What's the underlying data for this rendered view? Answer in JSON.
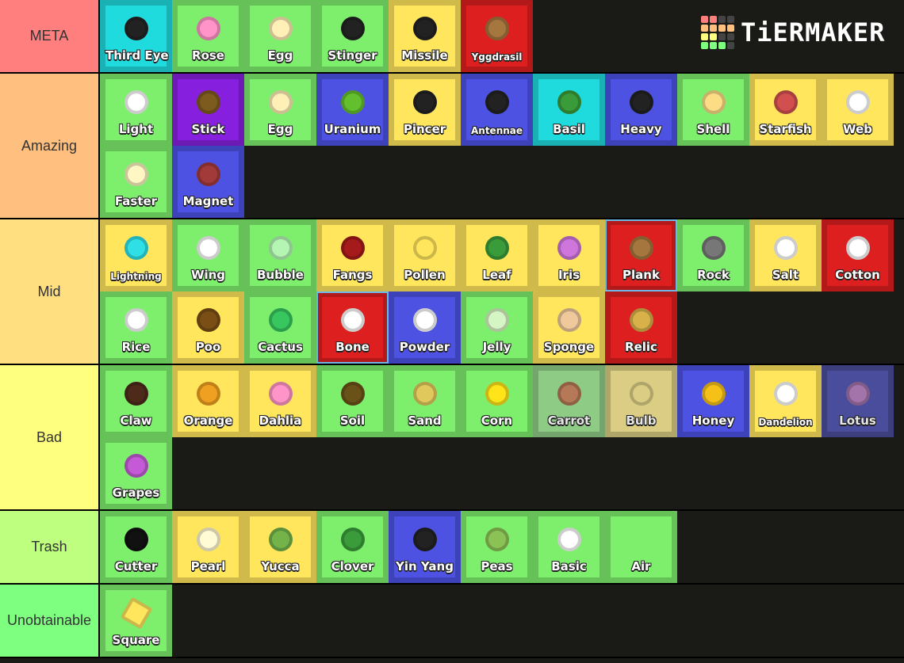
{
  "brand": {
    "name": "TiERMAKER",
    "grid_colors": [
      "#ff7f7f",
      "#ff7f7f",
      "#444",
      "#444",
      "#ffbf7f",
      "#ffbf7f",
      "#ffbf7f",
      "#ffbf7f",
      "#ffff7f",
      "#ffff7f",
      "#444",
      "#444",
      "#7fff7f",
      "#7fff7f",
      "#7fff7f",
      "#444"
    ]
  },
  "rarity_colors": {
    "common": [
      "#7eef6d",
      "#66c258"
    ],
    "unusual": [
      "#ffe65d",
      "#cfba4b"
    ],
    "rare": [
      "#4d52e3",
      "#3e42b8"
    ],
    "epic": [
      "#861fde",
      "#6d19b4"
    ],
    "legendary": [
      "#de1f1f",
      "#b41919"
    ],
    "mythic": [
      "#1fdbde",
      "#19b1b4"
    ]
  },
  "tiers": [
    {
      "label": "META",
      "color": "#ff7f7f",
      "rows": 1,
      "items": [
        {
          "name": "Third Eye",
          "rarity": "mythic",
          "icon": "#222"
        },
        {
          "name": "Rose",
          "rarity": "common",
          "icon": "#ff94c9"
        },
        {
          "name": "Egg",
          "rarity": "common",
          "icon": "#fff0b8"
        },
        {
          "name": "Stinger",
          "rarity": "common",
          "icon": "#222"
        },
        {
          "name": "Missile",
          "rarity": "unusual",
          "icon": "#222"
        },
        {
          "name": "Yggdrasil",
          "rarity": "legendary",
          "icon": "#a5763e",
          "small": true
        }
      ]
    },
    {
      "label": "Amazing",
      "color": "#ffbf7f",
      "rows": 2,
      "items": [
        {
          "name": "Light",
          "rarity": "common",
          "icon": "#ffffff"
        },
        {
          "name": "Stick",
          "rarity": "epic",
          "icon": "#7d5b1f"
        },
        {
          "name": "Egg",
          "rarity": "common",
          "icon": "#fff0b8"
        },
        {
          "name": "Uranium",
          "rarity": "rare",
          "icon": "#63bf2e"
        },
        {
          "name": "Pincer",
          "rarity": "unusual",
          "icon": "#222"
        },
        {
          "name": "Antennae",
          "rarity": "rare",
          "icon": "#222",
          "small": true
        },
        {
          "name": "Basil",
          "rarity": "mythic",
          "icon": "#3a9b3a"
        },
        {
          "name": "Heavy",
          "rarity": "rare",
          "icon": "#222"
        },
        {
          "name": "Shell",
          "rarity": "common",
          "icon": "#fcdd86"
        },
        {
          "name": "Starfish",
          "rarity": "unusual",
          "icon": "#d14f4f"
        },
        {
          "name": "Web",
          "rarity": "unusual",
          "icon": "#ffffff"
        },
        {
          "name": "Faster",
          "rarity": "common",
          "icon": "#fef7c3"
        },
        {
          "name": "Magnet",
          "rarity": "rare",
          "icon": "#a33a3a"
        }
      ]
    },
    {
      "label": "Mid",
      "color": "#ffdf7f",
      "rows": 2,
      "items": [
        {
          "name": "Lightning",
          "rarity": "unusual",
          "icon": "#2ee0e6",
          "small": true
        },
        {
          "name": "Wing",
          "rarity": "common",
          "icon": "#ffffff"
        },
        {
          "name": "Bubble",
          "rarity": "common",
          "icon": "#b4f5b4"
        },
        {
          "name": "Fangs",
          "rarity": "unusual",
          "icon": "#a51a1a"
        },
        {
          "name": "Pollen",
          "rarity": "unusual",
          "icon": "#ffe65d"
        },
        {
          "name": "Leaf",
          "rarity": "unusual",
          "icon": "#3a9b3a"
        },
        {
          "name": "Iris",
          "rarity": "unusual",
          "icon": "#ce76db"
        },
        {
          "name": "Plank",
          "rarity": "legendary",
          "icon": "#a5763e",
          "selected": true
        },
        {
          "name": "Rock",
          "rarity": "common",
          "icon": "#777777"
        },
        {
          "name": "Salt",
          "rarity": "unusual",
          "icon": "#ffffff"
        },
        {
          "name": "Cotton",
          "rarity": "legendary",
          "icon": "#ffffff"
        },
        {
          "name": "Rice",
          "rarity": "common",
          "icon": "#ffffff"
        },
        {
          "name": "Poo",
          "rarity": "unusual",
          "icon": "#7a4e14"
        },
        {
          "name": "Cactus",
          "rarity": "common",
          "icon": "#38c75f"
        },
        {
          "name": "Bone",
          "rarity": "legendary",
          "icon": "#ffffff",
          "selected": true
        },
        {
          "name": "Powder",
          "rarity": "rare",
          "icon": "#ffffff"
        },
        {
          "name": "Jelly",
          "rarity": "common",
          "icon": "#d6f5c4"
        },
        {
          "name": "Sponge",
          "rarity": "unusual",
          "icon": "#efc99b"
        },
        {
          "name": "Relic",
          "rarity": "legendary",
          "icon": "#d8b14a"
        }
      ]
    },
    {
      "label": "Bad",
      "color": "#ffff7f",
      "rows": 2,
      "items": [
        {
          "name": "Claw",
          "rarity": "common",
          "icon": "#4d2a1a"
        },
        {
          "name": "Orange",
          "rarity": "unusual",
          "icon": "#f0a020"
        },
        {
          "name": "Dahlia",
          "rarity": "unusual",
          "icon": "#ff94c9"
        },
        {
          "name": "Soil",
          "rarity": "common",
          "icon": "#695118"
        },
        {
          "name": "Sand",
          "rarity": "common",
          "icon": "#e0c85c"
        },
        {
          "name": "Corn",
          "rarity": "common",
          "icon": "#ffe419"
        },
        {
          "name": "Carrot",
          "rarity": "common",
          "icon": "#ee7f3f",
          "faded": true
        },
        {
          "name": "Bulb",
          "rarity": "unusual",
          "icon": "#ffe65d",
          "faded": true
        },
        {
          "name": "Honey",
          "rarity": "rare",
          "icon": "#f5c118"
        },
        {
          "name": "Dandelion",
          "rarity": "unusual",
          "icon": "#ffffff",
          "small": true
        },
        {
          "name": "Lotus",
          "rarity": "rare",
          "icon": "#ce76db",
          "faded": true
        },
        {
          "name": "Grapes",
          "rarity": "common",
          "icon": "#c45ad6"
        }
      ]
    },
    {
      "label": "Trash",
      "color": "#bfff7f",
      "rows": 1,
      "items": [
        {
          "name": "Cutter",
          "rarity": "common",
          "icon": "#111111"
        },
        {
          "name": "Pearl",
          "rarity": "unusual",
          "icon": "#fffbd4"
        },
        {
          "name": "Yucca",
          "rarity": "unusual",
          "icon": "#74b34a"
        },
        {
          "name": "Clover",
          "rarity": "common",
          "icon": "#3a9b3a"
        },
        {
          "name": "Yin Yang",
          "rarity": "rare",
          "icon": "#222"
        },
        {
          "name": "Peas",
          "rarity": "common",
          "icon": "#8ac255"
        },
        {
          "name": "Basic",
          "rarity": "common",
          "icon": "#ffffff"
        },
        {
          "name": "Air",
          "rarity": "common",
          "icon": ""
        }
      ]
    },
    {
      "label": "Unobtainable",
      "color": "#7fff7f",
      "rows": 1,
      "items": [
        {
          "name": "Square",
          "rarity": "common",
          "icon": "#ffe65d",
          "square": true
        }
      ]
    }
  ]
}
